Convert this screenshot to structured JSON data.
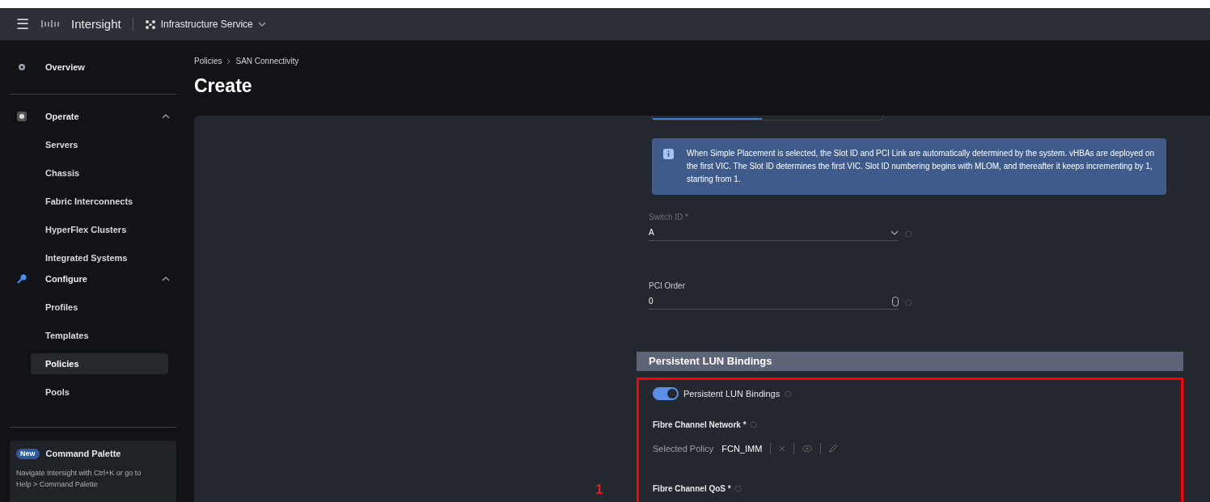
{
  "topbar": {
    "menu_icon": "☰",
    "brand": "Intersight",
    "service": "Infrastructure Service"
  },
  "sidebar": {
    "items": [
      {
        "label": "Overview",
        "kind": "top",
        "selected": false
      },
      {
        "label": "Operate",
        "kind": "group",
        "expanded": true,
        "children": [
          {
            "label": "Servers",
            "selected": false
          },
          {
            "label": "Chassis",
            "selected": false
          },
          {
            "label": "Fabric Interconnects",
            "selected": false
          },
          {
            "label": "HyperFlex Clusters",
            "selected": false
          },
          {
            "label": "Integrated Systems",
            "selected": false
          }
        ]
      },
      {
        "label": "Configure",
        "kind": "group",
        "expanded": true,
        "children": [
          {
            "label": "Profiles",
            "selected": false
          },
          {
            "label": "Templates",
            "selected": false
          },
          {
            "label": "Policies",
            "selected": true
          },
          {
            "label": "Pools",
            "selected": false
          }
        ]
      }
    ],
    "promo": {
      "badge": "New",
      "title": "Command Palette",
      "text": "Navigate Intersight with Ctrl+K or go to Help > Command Palette"
    }
  },
  "breadcrumb": [
    "Policies",
    "SAN Connectivity"
  ],
  "page_title": "Create",
  "info": "When Simple Placement is selected, the Slot ID and PCI Link are automatically determined by the system. vHBAs are deployed on the first VIC. The Slot ID determines the first VIC. Slot ID numbering begins with MLOM, and thereafter it keeps incrementing by 1, starting from 1.",
  "fields": [
    {
      "kind": "select",
      "label": "Switch ID *",
      "value": "A"
    },
    {
      "kind": "number",
      "label": "PCI Order",
      "value": "0"
    }
  ],
  "section": {
    "title": "Persistent LUN Bindings",
    "toggle": {
      "label": "Persistent LUN Bindings",
      "on": true
    },
    "policies": [
      {
        "label": "Fibre Channel Network *",
        "caption": "Selected Policy",
        "value": "FCN_IMM"
      }
    ],
    "next_label": "Fibre Channel QoS *"
  },
  "annotation": "1"
}
